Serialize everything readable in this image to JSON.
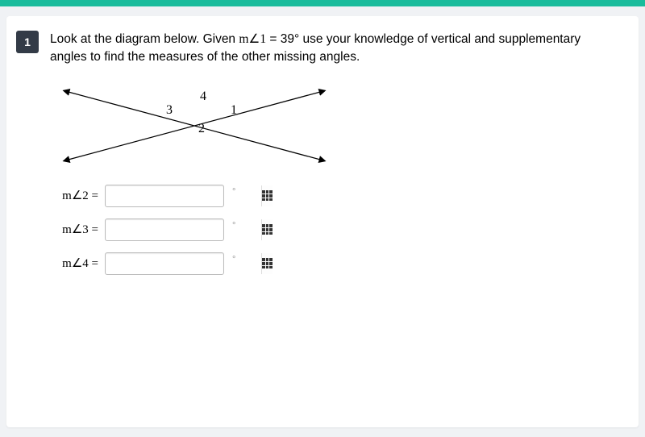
{
  "topbar_color": "#1abc9c",
  "question": {
    "number": "1",
    "text_pre": "Look at the diagram below. Given ",
    "given_var": "m∠1",
    "equals": " = ",
    "given_val": "39°",
    "text_post": " use your knowledge of vertical and supplementary angles to find the measures of the other missing angles."
  },
  "diagram": {
    "labels": {
      "l1": "1",
      "l2": "2",
      "l3": "3",
      "l4": "4"
    }
  },
  "answers": [
    {
      "label": "m∠2 =",
      "value": "",
      "unit": "°"
    },
    {
      "label": "m∠3 =",
      "value": "",
      "unit": "°"
    },
    {
      "label": "m∠4 =",
      "value": "",
      "unit": "°"
    }
  ]
}
